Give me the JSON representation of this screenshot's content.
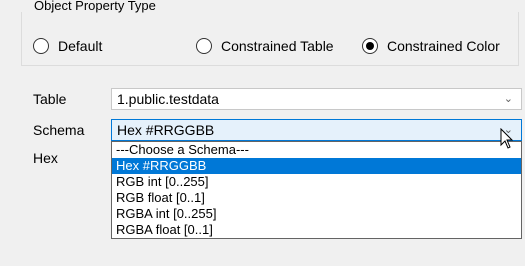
{
  "group": {
    "title": "Object Property Type",
    "radios": [
      {
        "label": "Default",
        "checked": false
      },
      {
        "label": "Constrained Table",
        "checked": false
      },
      {
        "label": "Constrained Color",
        "checked": true
      }
    ]
  },
  "table_field": {
    "label": "Table",
    "value": "1.public.testdata"
  },
  "schema_field": {
    "label": "Schema",
    "value": "Hex #RRGGBB",
    "options": [
      "---Choose a Schema---",
      "Hex #RRGGBB",
      "RGB int [0..255]",
      "RGB float [0..1]",
      "RGBA int [0..255]",
      "RGBA float [0..1]"
    ],
    "highlighted_option": "Hex #RRGGBB"
  },
  "hex_field": {
    "label": "Hex"
  },
  "icons": {
    "dropdown_arrow": "chevron-down-icon",
    "cursor": "mouse-pointer-icon"
  },
  "colors": {
    "selection": "#0078d7",
    "focus_background": "#e5f1fb"
  }
}
